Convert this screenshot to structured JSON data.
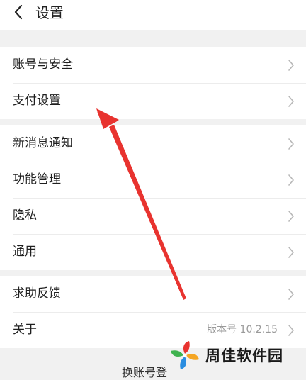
{
  "header": {
    "title": "设置",
    "back_icon": "chevron-left-icon"
  },
  "groups": [
    {
      "items": [
        {
          "label": "账号与安全"
        },
        {
          "label": "支付设置"
        }
      ]
    },
    {
      "items": [
        {
          "label": "新消息通知"
        },
        {
          "label": "功能管理"
        },
        {
          "label": "隐私"
        },
        {
          "label": "通用"
        }
      ]
    },
    {
      "items": [
        {
          "label": "求助反馈"
        },
        {
          "label": "关于",
          "value": "版本号 10.2.15"
        }
      ]
    }
  ],
  "footer": {
    "switch_account": "换账号登"
  },
  "annotation": {
    "arrow_color": "#e8332f"
  },
  "watermark": {
    "text": "周佳软件园"
  },
  "colors": {
    "background": "#f1f1f1",
    "card": "#ffffff",
    "divider": "#ececec",
    "secondary_text": "#9a9a9a"
  }
}
